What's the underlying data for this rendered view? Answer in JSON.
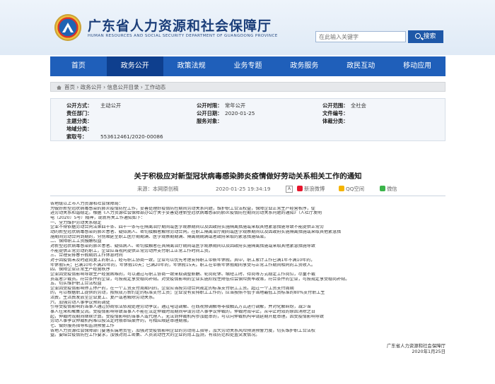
{
  "header": {
    "site_title": "广东省人力资源和社会保障厅",
    "site_subtitle": "HUMAN RESOURCES AND SOCIAL SECURITY DEPARTMENT OF GUANGDONG PROVINCE",
    "search_placeholder": "在此输入关键字",
    "search_button": "搜索"
  },
  "nav": [
    "首页",
    "政务公开",
    "政策法规",
    "业务专题",
    "政务服务",
    "政民互动",
    "移动应用"
  ],
  "breadcrumb": "首页 › 政务公开 › 信息公开目录 › 工作动态",
  "meta": {
    "row1": [
      {
        "label": "公开方式：",
        "value": "主动公开"
      },
      {
        "label": "公开时限：",
        "value": "常年公开"
      },
      {
        "label": "公开范围：",
        "value": "全社会"
      }
    ],
    "row2": [
      {
        "label": "责任部门：",
        "value": ""
      },
      {
        "label": "公开日期：",
        "value": "2020-01-25"
      },
      {
        "label": "文件编号：",
        "value": ""
      }
    ],
    "row3": [
      {
        "label": "主题分类：",
        "value": ""
      },
      {
        "label": "服务对象：",
        "value": ""
      },
      {
        "label": "体裁分类：",
        "value": ""
      }
    ],
    "row4": [
      {
        "label": "地域分类：",
        "value": ""
      }
    ],
    "row5": [
      {
        "label": "索取号：",
        "value": "553612461/2020-00086"
      }
    ]
  },
  "article": {
    "title": "关于积极应对新型冠状病毒感染肺炎疫情做好劳动关系相关工作的通知",
    "source": "来源：本网原创稿",
    "datetime": "2020-01-25 19:34:19",
    "share": [
      "新浪微博",
      "QQ空间",
      "微信"
    ],
    "paragraphs": [
      "各地级以上市人力资源和社会保障局：",
      "    为做好新型冠状病毒感染的肺炎疫情防控工作，妥善处理好疫情防控期间劳动关系问题，维护职工合法权益，保障企业正常生产经营秩序，促",
      "进劳动关系和谐稳定。根据《人力资源社会保障部办公厅关于妥善处理新型冠状病毒感染的肺炎疫情防控期间劳动关系问题的通知》（人社厅发明",
      "电〔2020〕5号）精神，现就有关工作通知如下：",
      "    一、全力维护劳动关系稳定",
      "    企业不得依据劳动合同法第四十条、四十一条与在隔离治疗期间或医学观察期间以及因政府实施隔离措施或采取其他紧急措施导致不能提供正常劳",
      "动的新型冠状病毒感染的肺炎患者、疑似病人、密切接触者解除劳动合同。在职工隔离治疗期间或医学观察期间以及因政府实施隔离措施或采取其他紧急措",
      "施期间劳动合同到期的，分别顺延至职工医疗期期满、医学观察期期满、隔离期期满或者政府采取的紧急措施结束。",
      "    二、保障职工工资报酬权益",
      "    对新型冠状病毒感染的肺炎患者、疑似病人、密切接触者在其隔离治疗期间或医学观察期间以及因政府实施隔离措施或采取其他紧急措施导致",
      "不能提供正常劳动的职工，企业应当视同提供正常劳动并支付职工正常工作时间工资。",
      "    三、合理安排春节假期后工作休息时间",
      "    对于因疫情未及时返岗复工的职工，经与职工协商一致，企业可以优先考虑安排职工带薪年休假。其中，职工累计工作已满1年不满10年的，",
      "年休假5天；已满10年不满20年的，年休假10天；已满20年的，年休假15天。职工在带薪年休假期间享受与正常工作期间相同的工资收入。",
      "    四、保障企业正常生产经营秩序",
      "    企业因受疫情影响导致生产经营困难的，可以通过与职工协商一致采取调整薪酬、轮岗轮休、缩短工时、待岗等方式稳定工作岗位，尽量不裁",
      "员或者少裁员。符合条件的企业，可按规定享受稳岗补贴。对受疫情影响的企业实施阶段性降低社会保险费率政策，符合条件的企业，可按规定享受稳岗补贴。",
      "    五、切实维护职工合法权益",
      "    企业因受疫情影响停工停产的，在一个工资支付周期内的，企业应当按劳动合同规定的标准支付职工工资。超过一个工资支付周期",
      "的，可以根据职工提供的劳动，按照双方新约定的标准支付工资；企业没有安排职工工作的，应当按照不低于当地最低工资标准的80%支付职工生",
      "活费，生活费发放至企业复工、复产或者解除劳动关系。",
      "    六、加强劳动人事争议预防调处",
      "    引导受疫情影响的当事人通过协商依法依规处理劳动争议，通过电话调解、在线视频调解等非接触式方式进行调解，并对化解纠纷，减少当",
      "事人往来和聚集交流。受疫情影响导致当事人不能在法定仲裁时效期间申请劳动人事争议仲裁的，仲裁时效中止，从中止时效的原因消除之日",
      "起，仲裁时效期间继续计算。受疫情影响的当事人或代理人，无法到仲裁机构参加庭审的，可以向仲裁机构申请延期开庭审理。因受疫情影响导致",
      "劳动人事争议仲裁机构难以按法定时限审结案件的，可相应顺延审理期限。",
      "    七、做好服务指导和监测预警工作",
      "    各地人力资源社会保障部门要落实属地责任，加强对受疫情影响企业的劳动用工指导，加大劳动关系风险预测预警力度，切实维护职工合法权",
      "益。要结合疫情防控工作要求，加强对用工密集、人员流动性大的企业的用工监测，有效防范和处置突发情况。"
    ],
    "signature": "广东省人力资源和社会保障厅",
    "signature_date": "2020年1月25日"
  }
}
